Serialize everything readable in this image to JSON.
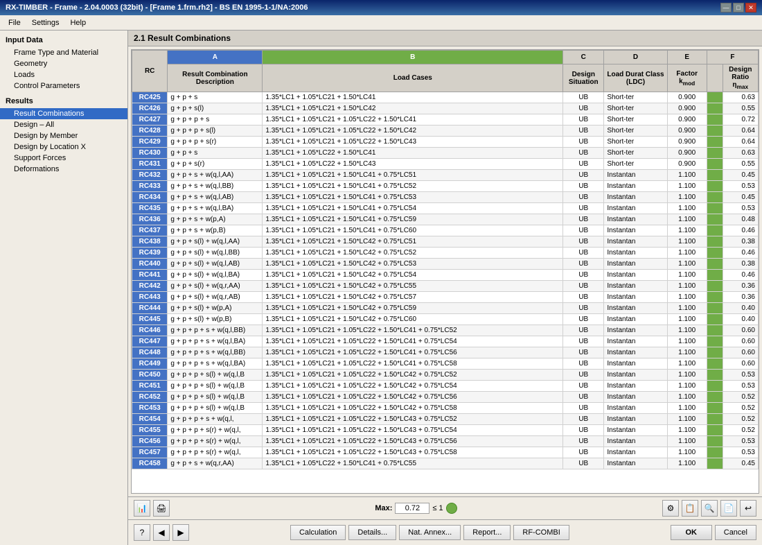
{
  "window": {
    "title": "RX-TIMBER - Frame - 2.04.0003 (32bit) - [Frame 1.frm.rh2] - BS EN 1995-1-1/NA:2006"
  },
  "titlebar": {
    "min_btn": "—",
    "max_btn": "□",
    "close_btn": "✕"
  },
  "menu": {
    "items": [
      "File",
      "Settings",
      "Help"
    ]
  },
  "sidebar": {
    "input_data_label": "Input Data",
    "items": [
      {
        "id": "frame-type",
        "label": "Frame Type and Material",
        "active": false
      },
      {
        "id": "geometry",
        "label": "Geometry",
        "active": false
      },
      {
        "id": "loads",
        "label": "Loads",
        "active": false
      },
      {
        "id": "control-parameters",
        "label": "Control Parameters",
        "active": false
      }
    ],
    "results_label": "Results",
    "result_items": [
      {
        "id": "result-combinations",
        "label": "Result Combinations",
        "active": true
      },
      {
        "id": "design-all",
        "label": "Design – All",
        "active": false
      },
      {
        "id": "design-by-member",
        "label": "Design by Member",
        "active": false
      },
      {
        "id": "design-by-location",
        "label": "Design by Location X",
        "active": false
      },
      {
        "id": "support-forces",
        "label": "Support Forces",
        "active": false
      },
      {
        "id": "deformations",
        "label": "Deformations",
        "active": false
      }
    ]
  },
  "panel": {
    "title": "2.1 Result Combinations"
  },
  "table": {
    "col_headers": [
      "A",
      "B",
      "C",
      "D",
      "E",
      "F"
    ],
    "row2_headers": [
      "RC",
      "Result Combination Description",
      "Load Cases",
      "Design Situation",
      "Load Duration Class (LDC)",
      "Factor k_mod",
      "",
      "Design Ratio η_max"
    ],
    "rows": [
      {
        "rc": "RC425",
        "desc": "g + p + s",
        "lc": "1.35*LC1 + 1.05*LC21 + 1.50*LC41",
        "sit": "UB",
        "ldc": "Short-ter",
        "factor": "0.900",
        "ratio": "0.63"
      },
      {
        "rc": "RC426",
        "desc": "g + p + s(l)",
        "lc": "1.35*LC1 + 1.05*LC21 + 1.50*LC42",
        "sit": "UB",
        "ldc": "Short-ter",
        "factor": "0.900",
        "ratio": "0.55"
      },
      {
        "rc": "RC427",
        "desc": "g + p + p + s",
        "lc": "1.35*LC1 + 1.05*LC21 + 1.05*LC22 + 1.50*LC41",
        "sit": "UB",
        "ldc": "Short-ter",
        "factor": "0.900",
        "ratio": "0.72"
      },
      {
        "rc": "RC428",
        "desc": "g + p + p + s(l)",
        "lc": "1.35*LC1 + 1.05*LC21 + 1.05*LC22 + 1.50*LC42",
        "sit": "UB",
        "ldc": "Short-ter",
        "factor": "0.900",
        "ratio": "0.64"
      },
      {
        "rc": "RC429",
        "desc": "g + p + p + s(r)",
        "lc": "1.35*LC1 + 1.05*LC21 + 1.05*LC22 + 1.50*LC43",
        "sit": "UB",
        "ldc": "Short-ter",
        "factor": "0.900",
        "ratio": "0.64"
      },
      {
        "rc": "RC430",
        "desc": "g + p + s",
        "lc": "1.35*LC1 + 1.05*LC22 + 1.50*LC41",
        "sit": "UB",
        "ldc": "Short-ter",
        "factor": "0.900",
        "ratio": "0.63"
      },
      {
        "rc": "RC431",
        "desc": "g + p + s(r)",
        "lc": "1.35*LC1 + 1.05*LC22 + 1.50*LC43",
        "sit": "UB",
        "ldc": "Short-ter",
        "factor": "0.900",
        "ratio": "0.55"
      },
      {
        "rc": "RC432",
        "desc": "g + p + s + w(q,l,AA)",
        "lc": "1.35*LC1 + 1.05*LC21 + 1.50*LC41 + 0.75*LC51",
        "sit": "UB",
        "ldc": "Instantan",
        "factor": "1.100",
        "ratio": "0.45"
      },
      {
        "rc": "RC433",
        "desc": "g + p + s + w(q,l,BB)",
        "lc": "1.35*LC1 + 1.05*LC21 + 1.50*LC41 + 0.75*LC52",
        "sit": "UB",
        "ldc": "Instantan",
        "factor": "1.100",
        "ratio": "0.53"
      },
      {
        "rc": "RC434",
        "desc": "g + p + s + w(q,l,AB)",
        "lc": "1.35*LC1 + 1.05*LC21 + 1.50*LC41 + 0.75*LC53",
        "sit": "UB",
        "ldc": "Instantan",
        "factor": "1.100",
        "ratio": "0.45"
      },
      {
        "rc": "RC435",
        "desc": "g + p + s + w(q,l,BA)",
        "lc": "1.35*LC1 + 1.05*LC21 + 1.50*LC41 + 0.75*LC54",
        "sit": "UB",
        "ldc": "Instantan",
        "factor": "1.100",
        "ratio": "0.53"
      },
      {
        "rc": "RC436",
        "desc": "g + p + s + w(p,A)",
        "lc": "1.35*LC1 + 1.05*LC21 + 1.50*LC41 + 0.75*LC59",
        "sit": "UB",
        "ldc": "Instantan",
        "factor": "1.100",
        "ratio": "0.48"
      },
      {
        "rc": "RC437",
        "desc": "g + p + s + w(p,B)",
        "lc": "1.35*LC1 + 1.05*LC21 + 1.50*LC41 + 0.75*LC60",
        "sit": "UB",
        "ldc": "Instantan",
        "factor": "1.100",
        "ratio": "0.46"
      },
      {
        "rc": "RC438",
        "desc": "g + p + s(l) + w(q,l,AA)",
        "lc": "1.35*LC1 + 1.05*LC21 + 1.50*LC42 + 0.75*LC51",
        "sit": "UB",
        "ldc": "Instantan",
        "factor": "1.100",
        "ratio": "0.38"
      },
      {
        "rc": "RC439",
        "desc": "g + p + s(l) + w(q,l,BB)",
        "lc": "1.35*LC1 + 1.05*LC21 + 1.50*LC42 + 0.75*LC52",
        "sit": "UB",
        "ldc": "Instantan",
        "factor": "1.100",
        "ratio": "0.46"
      },
      {
        "rc": "RC440",
        "desc": "g + p + s(l) + w(q,l,AB)",
        "lc": "1.35*LC1 + 1.05*LC21 + 1.50*LC42 + 0.75*LC53",
        "sit": "UB",
        "ldc": "Instantan",
        "factor": "1.100",
        "ratio": "0.38"
      },
      {
        "rc": "RC441",
        "desc": "g + p + s(l) + w(q,l,BA)",
        "lc": "1.35*LC1 + 1.05*LC21 + 1.50*LC42 + 0.75*LC54",
        "sit": "UB",
        "ldc": "Instantan",
        "factor": "1.100",
        "ratio": "0.46"
      },
      {
        "rc": "RC442",
        "desc": "g + p + s(l) + w(q,r,AA)",
        "lc": "1.35*LC1 + 1.05*LC21 + 1.50*LC42 + 0.75*LC55",
        "sit": "UB",
        "ldc": "Instantan",
        "factor": "1.100",
        "ratio": "0.36"
      },
      {
        "rc": "RC443",
        "desc": "g + p + s(l) + w(q,r,AB)",
        "lc": "1.35*LC1 + 1.05*LC21 + 1.50*LC42 + 0.75*LC57",
        "sit": "UB",
        "ldc": "Instantan",
        "factor": "1.100",
        "ratio": "0.36"
      },
      {
        "rc": "RC444",
        "desc": "g + p + s(l) + w(p,A)",
        "lc": "1.35*LC1 + 1.05*LC21 + 1.50*LC42 + 0.75*LC59",
        "sit": "UB",
        "ldc": "Instantan",
        "factor": "1.100",
        "ratio": "0.40"
      },
      {
        "rc": "RC445",
        "desc": "g + p + s(l) + w(p,B)",
        "lc": "1.35*LC1 + 1.05*LC21 + 1.50*LC42 + 0.75*LC60",
        "sit": "UB",
        "ldc": "Instantan",
        "factor": "1.100",
        "ratio": "0.40"
      },
      {
        "rc": "RC446",
        "desc": "g + p + p + s + w(q,l,BB)",
        "lc": "1.35*LC1 + 1.05*LC21 + 1.05*LC22 + 1.50*LC41 + 0.75*LC52",
        "sit": "UB",
        "ldc": "Instantan",
        "factor": "1.100",
        "ratio": "0.60"
      },
      {
        "rc": "RC447",
        "desc": "g + p + p + s + w(q,l,BA)",
        "lc": "1.35*LC1 + 1.05*LC21 + 1.05*LC22 + 1.50*LC41 + 0.75*LC54",
        "sit": "UB",
        "ldc": "Instantan",
        "factor": "1.100",
        "ratio": "0.60"
      },
      {
        "rc": "RC448",
        "desc": "g + p + p + s + w(q,l,BB)",
        "lc": "1.35*LC1 + 1.05*LC21 + 1.05*LC22 + 1.50*LC41 + 0.75*LC56",
        "sit": "UB",
        "ldc": "Instantan",
        "factor": "1.100",
        "ratio": "0.60"
      },
      {
        "rc": "RC449",
        "desc": "g + p + p + s + w(q,l,BA)",
        "lc": "1.35*LC1 + 1.05*LC21 + 1.05*LC22 + 1.50*LC41 + 0.75*LC58",
        "sit": "UB",
        "ldc": "Instantan",
        "factor": "1.100",
        "ratio": "0.60"
      },
      {
        "rc": "RC450",
        "desc": "g + p + p + s(l) + w(q,l,B",
        "lc": "1.35*LC1 + 1.05*LC21 + 1.05*LC22 + 1.50*LC42 + 0.75*LC52",
        "sit": "UB",
        "ldc": "Instantan",
        "factor": "1.100",
        "ratio": "0.53"
      },
      {
        "rc": "RC451",
        "desc": "g + p + p + s(l) + w(q,l,B",
        "lc": "1.35*LC1 + 1.05*LC21 + 1.05*LC22 + 1.50*LC42 + 0.75*LC54",
        "sit": "UB",
        "ldc": "Instantan",
        "factor": "1.100",
        "ratio": "0.53"
      },
      {
        "rc": "RC452",
        "desc": "g + p + p + s(l) + w(q,l,B",
        "lc": "1.35*LC1 + 1.05*LC21 + 1.05*LC22 + 1.50*LC42 + 0.75*LC56",
        "sit": "UB",
        "ldc": "Instantan",
        "factor": "1.100",
        "ratio": "0.52"
      },
      {
        "rc": "RC453",
        "desc": "g + p + p + s(l) + w(q,l,B",
        "lc": "1.35*LC1 + 1.05*LC21 + 1.05*LC22 + 1.50*LC42 + 0.75*LC58",
        "sit": "UB",
        "ldc": "Instantan",
        "factor": "1.100",
        "ratio": "0.52"
      },
      {
        "rc": "RC454",
        "desc": "g + p + p + s + w(q,l,",
        "lc": "1.35*LC1 + 1.05*LC21 + 1.05*LC22 + 1.50*LC43 + 0.75*LC52",
        "sit": "UB",
        "ldc": "Instantan",
        "factor": "1.100",
        "ratio": "0.52"
      },
      {
        "rc": "RC455",
        "desc": "g + p + p + s(r) + w(q,l,",
        "lc": "1.35*LC1 + 1.05*LC21 + 1.05*LC22 + 1.50*LC43 + 0.75*LC54",
        "sit": "UB",
        "ldc": "Instantan",
        "factor": "1.100",
        "ratio": "0.52"
      },
      {
        "rc": "RC456",
        "desc": "g + p + p + s(r) + w(q,l,",
        "lc": "1.35*LC1 + 1.05*LC21 + 1.05*LC22 + 1.50*LC43 + 0.75*LC56",
        "sit": "UB",
        "ldc": "Instantan",
        "factor": "1.100",
        "ratio": "0.53"
      },
      {
        "rc": "RC457",
        "desc": "g + p + p + s(r) + w(q,l,",
        "lc": "1.35*LC1 + 1.05*LC21 + 1.05*LC22 + 1.50*LC43 + 0.75*LC58",
        "sit": "UB",
        "ldc": "Instantan",
        "factor": "1.100",
        "ratio": "0.53"
      },
      {
        "rc": "RC458",
        "desc": "g + p + s + w(q,r,AA)",
        "lc": "1.35*LC1 + 1.05*LC22 + 1.50*LC41 + 0.75*LC55",
        "sit": "UB",
        "ldc": "Instantan",
        "factor": "1.100",
        "ratio": "0.45"
      }
    ]
  },
  "bottom_toolbar": {
    "max_label": "Max:",
    "max_value": "0.72",
    "leq": "≤ 1"
  },
  "footer": {
    "calculation_btn": "Calculation",
    "details_btn": "Details...",
    "nat_annex_btn": "Nat. Annex...",
    "report_btn": "Report...",
    "rf_combi_btn": "RF-COMBI",
    "ok_btn": "OK",
    "cancel_btn": "Cancel"
  }
}
